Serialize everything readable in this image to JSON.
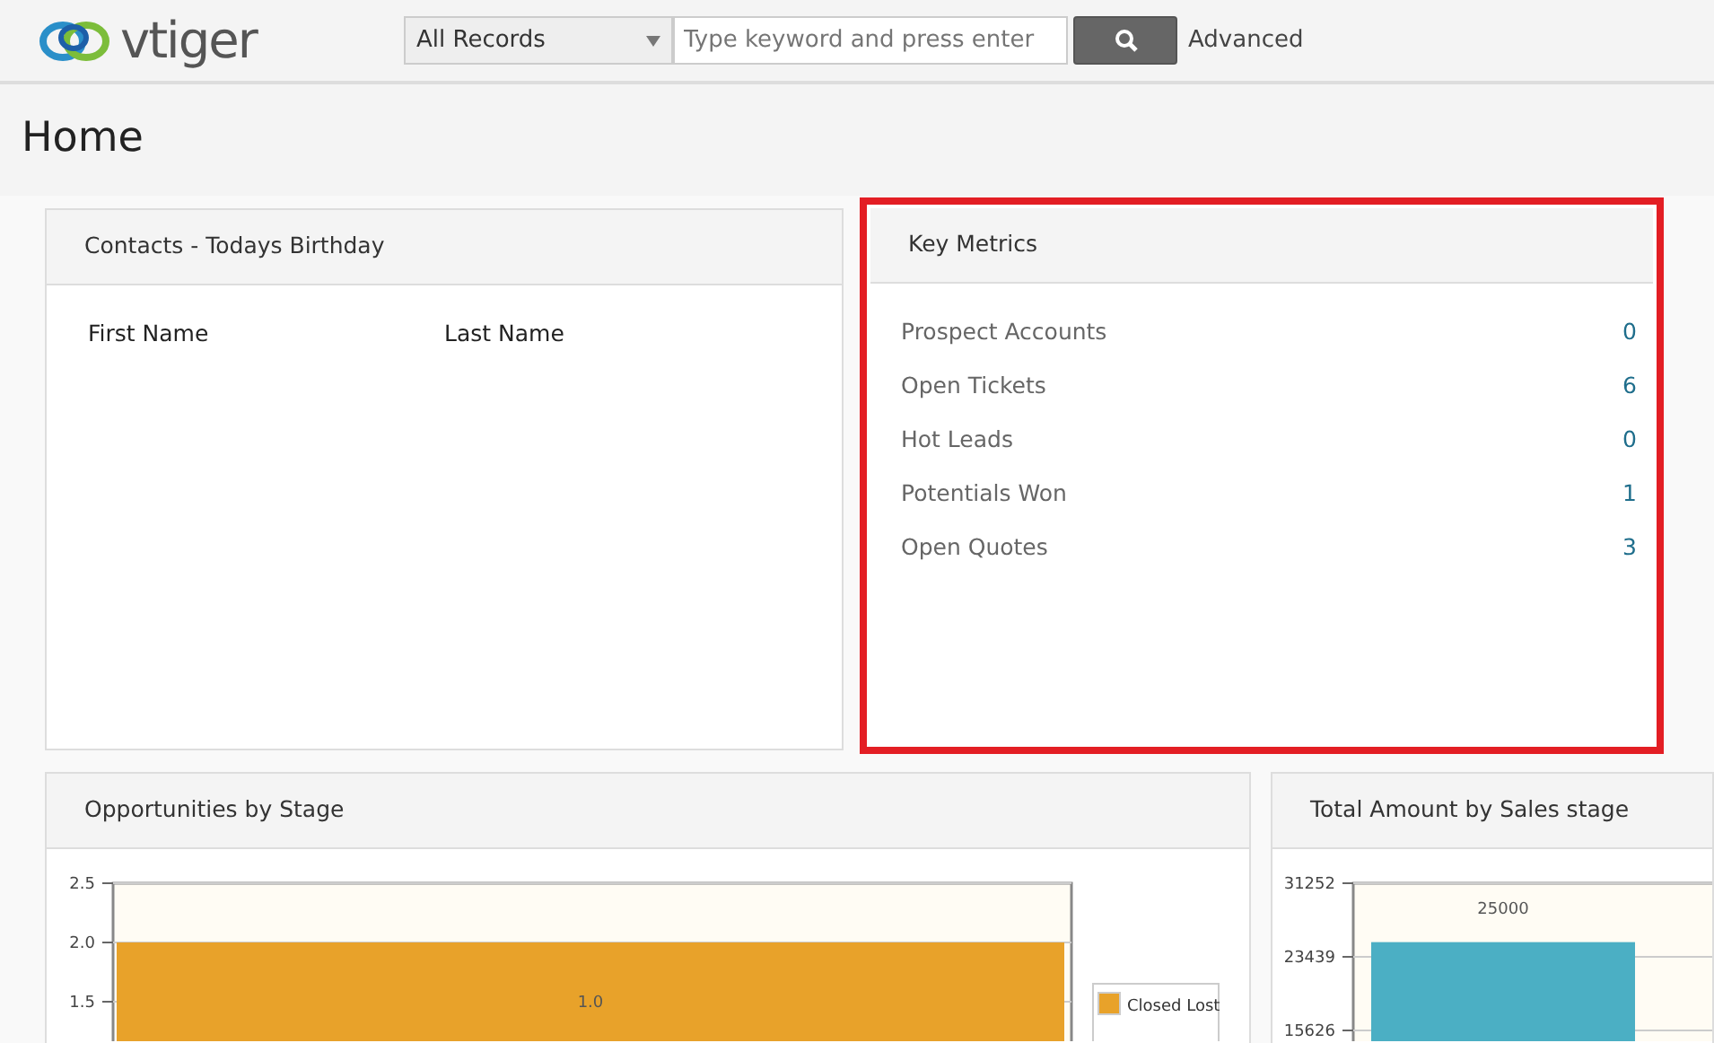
{
  "header": {
    "logo_text": "vtiger",
    "search_scope": "All Records",
    "search": {
      "placeholder": "Type keyword and press enter"
    },
    "advanced_link": "Advanced"
  },
  "page_title": "Home",
  "widgets": [
    {
      "kind": "table",
      "title": "Contacts - Todays Birthday",
      "highlighted": false,
      "columns": [
        "First Name",
        "Last Name"
      ]
    },
    {
      "kind": "metrics",
      "title": "Key Metrics",
      "highlighted": true,
      "items": [
        {
          "label": "Prospect Accounts",
          "value": "0"
        },
        {
          "label": "Open Tickets",
          "value": "6"
        },
        {
          "label": "Hot Leads",
          "value": "0"
        },
        {
          "label": "Potentials Won",
          "value": "1"
        },
        {
          "label": "Open Quotes",
          "value": "3"
        }
      ]
    },
    {
      "kind": "chart",
      "title": "Opportunities by Stage",
      "highlighted": false,
      "chart_data": {
        "type": "bar",
        "ylim": [
          1.1667,
          2.5
        ],
        "yticks": [
          {
            "value": 2.5,
            "label": "2.5"
          },
          {
            "value": 2.0,
            "label": "2.0"
          },
          {
            "value": 1.5,
            "label": "1.5"
          }
        ],
        "series": [
          {
            "name": "Closed Lost",
            "color": "#e8a22a",
            "values": [
              2.0
            ]
          }
        ],
        "value_labels": [
          "1.0"
        ]
      }
    },
    {
      "kind": "chart",
      "title": "Total Amount by Sales stage",
      "highlighted": false,
      "chart_data": {
        "type": "bar",
        "ylim": [
          14482,
          31252
        ],
        "yticks": [
          31252,
          23439,
          15626
        ],
        "series": [
          {
            "color": "#4bafc4",
            "values": [
              25000
            ]
          }
        ],
        "value_labels": [
          "25000"
        ]
      }
    }
  ]
}
